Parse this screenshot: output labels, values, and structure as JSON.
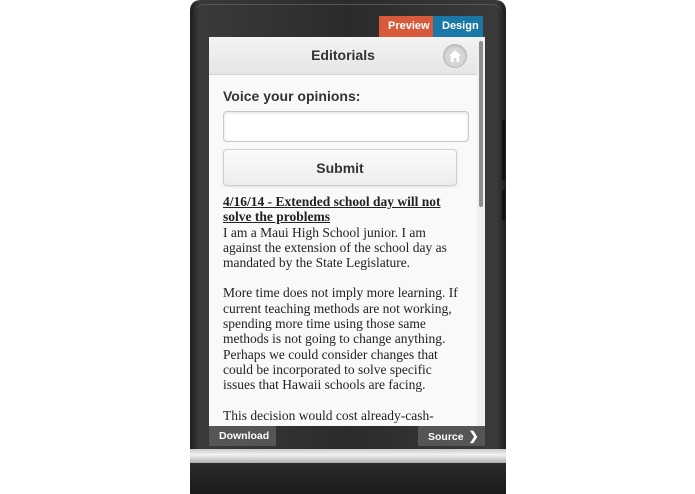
{
  "mode_tabs": {
    "preview": "Preview",
    "design": "Design"
  },
  "header": {
    "title": "Editorials",
    "home_icon": "home-icon"
  },
  "form": {
    "label": "Voice your opinions:",
    "input_value": "",
    "submit_label": "Submit"
  },
  "editorial": {
    "heading": "4/16/14 - Extended school day will not solve the problems",
    "paragraphs": [
      "I am a Maui High School junior. I am against the extension of the school day as mandated by the State Legislature.",
      "More time does not imply more learning. If current teaching methods are not working, spending more time using those same methods is not going to change anything. Perhaps we could consider changes that could be incorporated to solve specific issues that Hawaii schools are facing.",
      "This decision would cost already-cash-"
    ]
  },
  "bottom_bar": {
    "download": "Download",
    "source": "Source",
    "source_icon": "chevron-right-icon"
  },
  "colors": {
    "preview_tab": "#d95a3b",
    "design_tab": "#1a78a8",
    "bottom_buttons": "#555555"
  }
}
